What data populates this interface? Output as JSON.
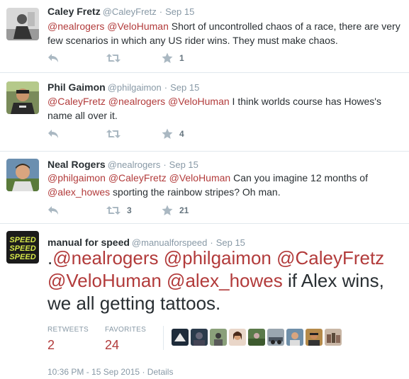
{
  "tweets": [
    {
      "name": "Caley Fretz",
      "handle": "@CaleyFretz",
      "sep": "·",
      "time": "Sep 15",
      "mentions": [
        "@nealrogers",
        "@VeloHuman"
      ],
      "text": "Short of uncontrolled chaos of a race, there are very few scenarios in which any US rider wins. They must make chaos.",
      "retweets": "",
      "favorites": "1"
    },
    {
      "name": "Phil Gaimon",
      "handle": "@philgaimon",
      "sep": "·",
      "time": "Sep 15",
      "mentions": [
        "@CaleyFretz",
        "@nealrogers",
        "@VeloHuman"
      ],
      "text": "I think worlds course has Howes's name all over it.",
      "retweets": "",
      "favorites": "4"
    },
    {
      "name": "Neal Rogers",
      "handle": "@nealrogers",
      "sep": "·",
      "time": "Sep 15",
      "mentions": [
        "@philgaimon",
        "@CaleyFretz",
        "@VeloHuman"
      ],
      "text": "Can you imagine 12 months of",
      "mention_inline": "@alex_howes",
      "text_after": "sporting the rainbow stripes? Oh man.",
      "retweets": "3",
      "favorites": "21"
    }
  ],
  "main_tweet": {
    "name": "manual for speed",
    "handle": "@manualforspeed",
    "sep": "·",
    "time": "Sep 15",
    "avatar_text": [
      "SPEED",
      "SPEED",
      "SPEED"
    ],
    "lead": ".",
    "mentions": [
      "@nealrogers",
      "@philgaimon",
      "@CaleyFretz",
      "@VeloHuman",
      "@alex_howes"
    ],
    "text": "if Alex wins, we all getting tattoos.",
    "retweets_label": "RETWEETS",
    "retweets": "2",
    "favorites_label": "FAVORITES",
    "favorites": "24",
    "timestamp": "10:36 PM - 15 Sep 2015",
    "details_sep": "·",
    "details_label": "Details"
  },
  "colors": {
    "mention": "#b23b3b",
    "icon": "#aab8c2",
    "avatar_mfs_bg": "#1b1b1b",
    "avatar_mfs_text": "#d7e84a"
  }
}
